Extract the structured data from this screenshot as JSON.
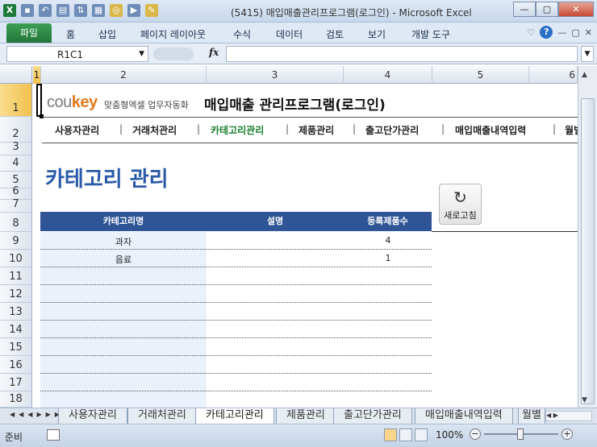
{
  "window": {
    "title": "(5415) 매입매출관리프로그램(로그인)  -  Microsoft Excel",
    "controls": [
      "—",
      "▢",
      "✕"
    ]
  },
  "ribbon": {
    "file": "파일",
    "tabs": [
      "홈",
      "삽입",
      "페이지 레이아웃",
      "수식",
      "데이터",
      "검토",
      "보기",
      "개발 도구"
    ]
  },
  "formula_bar": {
    "name_box": "R1C1",
    "fx": "fx",
    "value": ""
  },
  "columns": [
    "1",
    "2",
    "3",
    "4",
    "5",
    "6"
  ],
  "rows": [
    "1",
    "2",
    "3",
    "4",
    "5",
    "6",
    "7",
    "8",
    "9",
    "10",
    "11",
    "12",
    "13",
    "14",
    "15",
    "16",
    "17",
    "18"
  ],
  "brand": {
    "logo_cou": "cou",
    "logo_key": "key",
    "logo_sub": "맞춤형엑셀 업무자동화",
    "app_title": "매입매출 관리프로그램(로그인)"
  },
  "nav": {
    "items": [
      "사용자관리",
      "거래처관리",
      "카테고리관리",
      "제품관리",
      "출고단가관리",
      "매입매출내역입력",
      "월별"
    ],
    "active": "카테고리관리"
  },
  "page": {
    "title": "카테고리 관리",
    "refresh_label": "새로고침"
  },
  "table": {
    "headers": [
      "카테고리명",
      "설명",
      "등록제품수"
    ],
    "rows": [
      {
        "name": "과자",
        "desc": "",
        "count": "4"
      },
      {
        "name": "음료",
        "desc": "",
        "count": "1"
      },
      {
        "name": "",
        "desc": "",
        "count": ""
      },
      {
        "name": "",
        "desc": "",
        "count": ""
      },
      {
        "name": "",
        "desc": "",
        "count": ""
      },
      {
        "name": "",
        "desc": "",
        "count": ""
      },
      {
        "name": "",
        "desc": "",
        "count": ""
      },
      {
        "name": "",
        "desc": "",
        "count": ""
      },
      {
        "name": "",
        "desc": "",
        "count": ""
      },
      {
        "name": "",
        "desc": "",
        "count": ""
      }
    ]
  },
  "sheet_tabs": {
    "items": [
      "사용자관리",
      "거래처관리",
      "카테고리관리",
      "제품관리",
      "출고단가관리",
      "매입매출내역입력",
      "월별"
    ],
    "active": "카테고리관리"
  },
  "status": {
    "ready": "준비",
    "zoom": "100%"
  }
}
